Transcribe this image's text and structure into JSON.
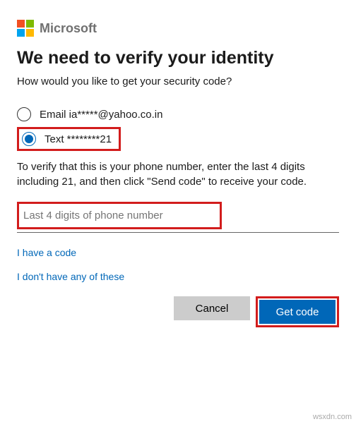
{
  "brand": {
    "name": "Microsoft"
  },
  "title": "We need to verify your identity",
  "subtitle": "How would you like to get your security code?",
  "options": {
    "email": {
      "label": "Email ia*****@yahoo.co.in",
      "selected": false
    },
    "text": {
      "label": "Text ********21",
      "selected": true
    }
  },
  "instruction": "To verify that this is your phone number, enter the last 4 digits including 21, and then click \"Send code\" to receive your code.",
  "input": {
    "placeholder": "Last 4 digits of phone number",
    "value": ""
  },
  "links": {
    "have_code": "I have a code",
    "none": "I don't have any of these"
  },
  "buttons": {
    "cancel": "Cancel",
    "submit": "Get code"
  },
  "watermark": "wsxdn.com"
}
